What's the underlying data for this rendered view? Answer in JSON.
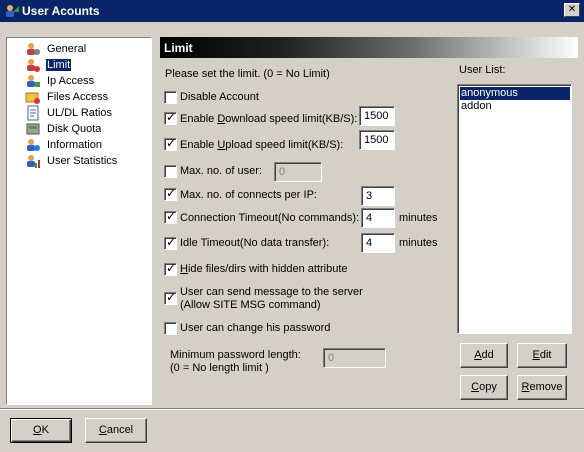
{
  "window": {
    "title": "User Acounts",
    "close_glyph": "✕"
  },
  "tree": {
    "items": [
      {
        "label": "General",
        "icon": "user-gear-icon"
      },
      {
        "label": "Limit",
        "icon": "user-limit-icon",
        "selected": true
      },
      {
        "label": "Ip Access",
        "icon": "user-network-icon"
      },
      {
        "label": "Files Access",
        "icon": "folder-access-icon"
      },
      {
        "label": "UL/DL Ratios",
        "icon": "ratio-document-icon"
      },
      {
        "label": "Disk Quota",
        "icon": "disk-quota-icon"
      },
      {
        "label": "Information",
        "icon": "user-info-icon"
      },
      {
        "label": "User Statistics",
        "icon": "user-stats-icon"
      }
    ]
  },
  "panel": {
    "title": "Limit",
    "intro": "Please set the  limit.    (0 = No Limit)",
    "disable_account": {
      "label": "Disable Account",
      "checked": false
    },
    "download_limit": {
      "label_pre": "Enable ",
      "label_u": "D",
      "label_post": "ownload speed limit(KB/S):",
      "checked": true,
      "value": "1500"
    },
    "upload_limit": {
      "label_pre": "Enable ",
      "label_u": "U",
      "label_post": "pload speed limit(KB/S):",
      "checked": true,
      "value": "1500"
    },
    "max_users": {
      "label": "Max. no. of user:",
      "checked": false,
      "value": "0"
    },
    "max_connects": {
      "label": "Max. no. of connects per IP:",
      "checked": true,
      "value": "3"
    },
    "connection_timeout": {
      "label": "Connection Timeout(No commands):",
      "checked": true,
      "value": "4",
      "unit": "minutes"
    },
    "idle_timeout": {
      "label": "Idle Timeout(No data transfer):",
      "checked": true,
      "value": "4",
      "unit": "minutes"
    },
    "hide_files": {
      "label_u": "H",
      "label_post": "ide files/dirs with hidden attribute",
      "checked": true
    },
    "send_message": {
      "line1": "User can send message to the server",
      "line2": "(Allow SITE MSG command)",
      "checked": true
    },
    "change_password": {
      "label": "User can change his password",
      "checked": false
    },
    "min_password": {
      "line1": "Minimum password length:",
      "line2": "(0 = No length limit )",
      "value": "0"
    }
  },
  "user_list": {
    "label": "User List:",
    "users": [
      {
        "name": "anonymous",
        "selected": true
      },
      {
        "name": "addon",
        "selected": false
      }
    ],
    "add_u": "A",
    "add_rest": "dd",
    "edit_u": "E",
    "edit_rest": "dit",
    "copy_u": "C",
    "copy_rest": "opy",
    "remove_u": "R",
    "remove_rest": "emove"
  },
  "footer": {
    "ok_u": "O",
    "ok_rest": "K",
    "cancel_pre": "",
    "cancel_u": "C",
    "cancel_rest": "ancel"
  },
  "colors": {
    "selection": "#0a246a",
    "face": "#d4d0c8"
  }
}
